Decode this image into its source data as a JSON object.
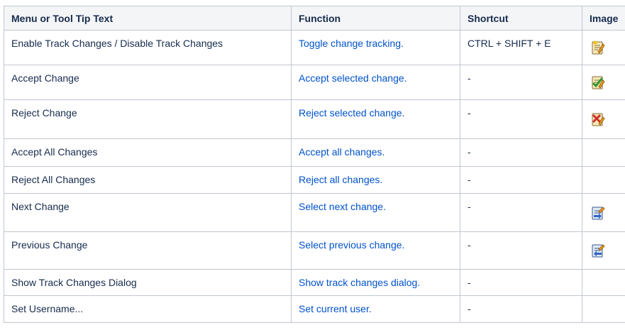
{
  "headers": [
    "Menu or Tool Tip Text",
    "Function",
    "Shortcut",
    "Image"
  ],
  "rows": [
    {
      "text": "Enable Track Changes / Disable Track Changes",
      "function": "Toggle change tracking.",
      "shortcut": "CTRL + SHIFT + E",
      "icon": "track-changes-icon"
    },
    {
      "text": "Accept Change",
      "function": "Accept selected change.",
      "shortcut": "-",
      "icon": "accept-change-icon"
    },
    {
      "text": "Reject Change",
      "function": "Reject selected change.",
      "shortcut": "-",
      "icon": "reject-change-icon"
    },
    {
      "text": "Accept All Changes",
      "function": "Accept all changes.",
      "shortcut": "-",
      "image_text": "-"
    },
    {
      "text": "Reject All Changes",
      "function": "Reject all changes.",
      "shortcut": "-",
      "image_text": "-"
    },
    {
      "text": "Next Change",
      "function": "Select next change.",
      "shortcut": "-",
      "icon": "next-change-icon"
    },
    {
      "text": "Previous Change",
      "function": "Select previous change.",
      "shortcut": "-",
      "icon": "previous-change-icon"
    },
    {
      "text": "Show Track Changes Dialog",
      "function": "Show track changes dialog.",
      "shortcut": "-",
      "image_text": "-"
    },
    {
      "text": "Set Username...",
      "function": "Set current user.",
      "shortcut": "-",
      "image_text": "-"
    }
  ]
}
